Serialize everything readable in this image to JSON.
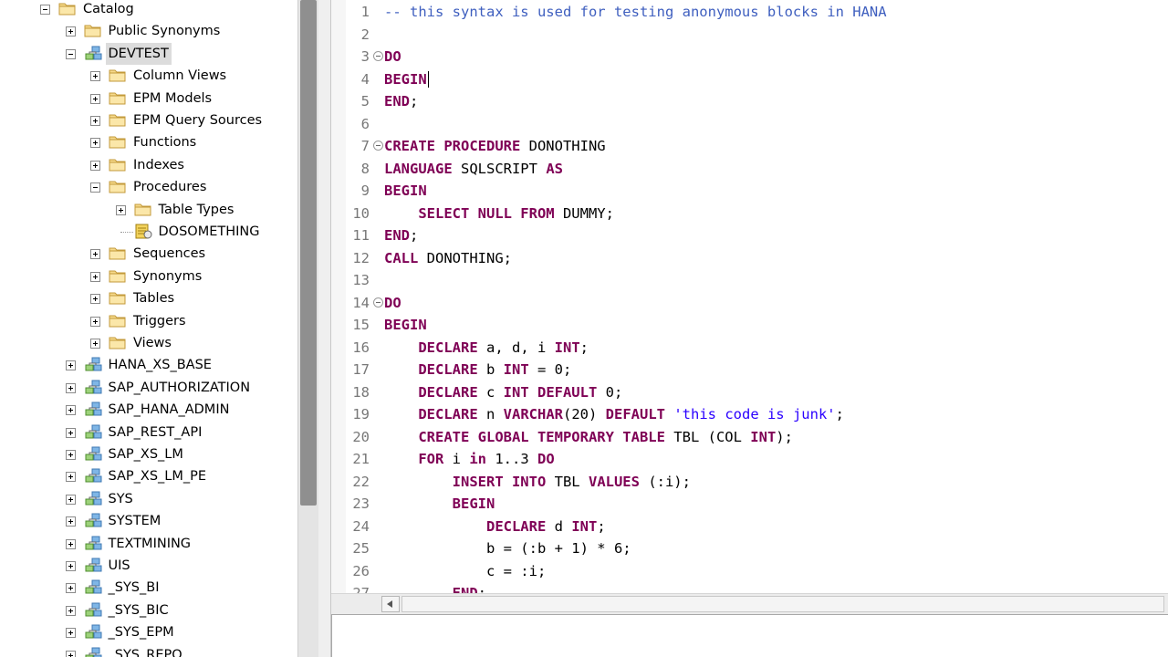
{
  "tree": {
    "nodes": [
      {
        "label": "Catalog",
        "level": 0,
        "expander": "minus",
        "icon": "folder-icon"
      },
      {
        "label": "Public Synonyms",
        "level": 1,
        "expander": "plus",
        "icon": "folder-icon"
      },
      {
        "label": "DEVTEST",
        "level": 1,
        "expander": "minus",
        "icon": "schema-icon",
        "selected": true
      },
      {
        "label": "Column Views",
        "level": 2,
        "expander": "plus",
        "icon": "folder-icon"
      },
      {
        "label": "EPM Models",
        "level": 2,
        "expander": "plus",
        "icon": "folder-icon"
      },
      {
        "label": "EPM Query Sources",
        "level": 2,
        "expander": "plus",
        "icon": "folder-icon"
      },
      {
        "label": "Functions",
        "level": 2,
        "expander": "plus",
        "icon": "folder-icon"
      },
      {
        "label": "Indexes",
        "level": 2,
        "expander": "plus",
        "icon": "folder-icon"
      },
      {
        "label": "Procedures",
        "level": 2,
        "expander": "minus",
        "icon": "folder-icon"
      },
      {
        "label": "Table Types",
        "level": 3,
        "expander": "plus",
        "icon": "folder-icon"
      },
      {
        "label": "DOSOMETHING",
        "level": 3,
        "expander": "none",
        "icon": "procedure-icon"
      },
      {
        "label": "Sequences",
        "level": 2,
        "expander": "plus",
        "icon": "folder-icon"
      },
      {
        "label": "Synonyms",
        "level": 2,
        "expander": "plus",
        "icon": "folder-icon"
      },
      {
        "label": "Tables",
        "level": 2,
        "expander": "plus",
        "icon": "folder-icon"
      },
      {
        "label": "Triggers",
        "level": 2,
        "expander": "plus",
        "icon": "folder-icon"
      },
      {
        "label": "Views",
        "level": 2,
        "expander": "plus",
        "icon": "folder-icon"
      },
      {
        "label": "HANA_XS_BASE",
        "level": 1,
        "expander": "plus",
        "icon": "schema-icon"
      },
      {
        "label": "SAP_AUTHORIZATION",
        "level": 1,
        "expander": "plus",
        "icon": "schema-icon"
      },
      {
        "label": "SAP_HANA_ADMIN",
        "level": 1,
        "expander": "plus",
        "icon": "schema-icon"
      },
      {
        "label": "SAP_REST_API",
        "level": 1,
        "expander": "plus",
        "icon": "schema-icon"
      },
      {
        "label": "SAP_XS_LM",
        "level": 1,
        "expander": "plus",
        "icon": "schema-icon"
      },
      {
        "label": "SAP_XS_LM_PE",
        "level": 1,
        "expander": "plus",
        "icon": "schema-icon"
      },
      {
        "label": "SYS",
        "level": 1,
        "expander": "plus",
        "icon": "schema-icon"
      },
      {
        "label": "SYSTEM",
        "level": 1,
        "expander": "plus",
        "icon": "schema-icon"
      },
      {
        "label": "TEXTMINING",
        "level": 1,
        "expander": "plus",
        "icon": "schema-icon"
      },
      {
        "label": "UIS",
        "level": 1,
        "expander": "plus",
        "icon": "schema-icon"
      },
      {
        "label": "_SYS_BI",
        "level": 1,
        "expander": "plus",
        "icon": "schema-icon"
      },
      {
        "label": "_SYS_BIC",
        "level": 1,
        "expander": "plus",
        "icon": "schema-icon"
      },
      {
        "label": "_SYS_EPM",
        "level": 1,
        "expander": "plus",
        "icon": "schema-icon"
      },
      {
        "label": "_SYS_REPO",
        "level": 1,
        "expander": "plus",
        "icon": "schema-icon"
      }
    ]
  },
  "editor": {
    "lines": [
      {
        "n": "1",
        "fold": false,
        "tokens": [
          [
            "cm",
            "-- this syntax is used for testing anonymous blocks in HANA"
          ]
        ]
      },
      {
        "n": "2",
        "fold": false,
        "tokens": []
      },
      {
        "n": "3",
        "fold": true,
        "tokens": [
          [
            "kw",
            "DO"
          ]
        ]
      },
      {
        "n": "4",
        "fold": false,
        "tokens": [
          [
            "kw",
            "BEGIN"
          ]
        ],
        "caret": true
      },
      {
        "n": "5",
        "fold": false,
        "tokens": [
          [
            "kw",
            "END"
          ],
          [
            "tx",
            ";"
          ]
        ]
      },
      {
        "n": "6",
        "fold": false,
        "tokens": []
      },
      {
        "n": "7",
        "fold": true,
        "tokens": [
          [
            "kw",
            "CREATE PROCEDURE"
          ],
          [
            "tx",
            " DONOTHING"
          ]
        ]
      },
      {
        "n": "8",
        "fold": false,
        "tokens": [
          [
            "kw",
            "LANGUAGE"
          ],
          [
            "tx",
            " SQLSCRIPT "
          ],
          [
            "kw",
            "AS"
          ]
        ]
      },
      {
        "n": "9",
        "fold": false,
        "tokens": [
          [
            "kw",
            "BEGIN"
          ]
        ]
      },
      {
        "n": "10",
        "fold": false,
        "tokens": [
          [
            "tx",
            "    "
          ],
          [
            "kw",
            "SELECT NULL FROM"
          ],
          [
            "tx",
            " DUMMY;"
          ]
        ]
      },
      {
        "n": "11",
        "fold": false,
        "tokens": [
          [
            "kw",
            "END"
          ],
          [
            "tx",
            ";"
          ]
        ]
      },
      {
        "n": "12",
        "fold": false,
        "tokens": [
          [
            "kw",
            "CALL"
          ],
          [
            "tx",
            " DONOTHING;"
          ]
        ]
      },
      {
        "n": "13",
        "fold": false,
        "tokens": []
      },
      {
        "n": "14",
        "fold": true,
        "tokens": [
          [
            "kw",
            "DO"
          ]
        ]
      },
      {
        "n": "15",
        "fold": false,
        "tokens": [
          [
            "kw",
            "BEGIN"
          ]
        ]
      },
      {
        "n": "16",
        "fold": false,
        "tokens": [
          [
            "tx",
            "    "
          ],
          [
            "kw",
            "DECLARE"
          ],
          [
            "tx",
            " a, d, i "
          ],
          [
            "kw",
            "INT"
          ],
          [
            "tx",
            ";"
          ]
        ]
      },
      {
        "n": "17",
        "fold": false,
        "tokens": [
          [
            "tx",
            "    "
          ],
          [
            "kw",
            "DECLARE"
          ],
          [
            "tx",
            " b "
          ],
          [
            "kw",
            "INT"
          ],
          [
            "tx",
            " = 0;"
          ]
        ]
      },
      {
        "n": "18",
        "fold": false,
        "tokens": [
          [
            "tx",
            "    "
          ],
          [
            "kw",
            "DECLARE"
          ],
          [
            "tx",
            " c "
          ],
          [
            "kw",
            "INT DEFAULT"
          ],
          [
            "tx",
            " 0;"
          ]
        ]
      },
      {
        "n": "19",
        "fold": false,
        "tokens": [
          [
            "tx",
            "    "
          ],
          [
            "kw",
            "DECLARE"
          ],
          [
            "tx",
            " n "
          ],
          [
            "kw",
            "VARCHAR"
          ],
          [
            "tx",
            "(20) "
          ],
          [
            "kw",
            "DEFAULT"
          ],
          [
            "tx",
            " "
          ],
          [
            "st",
            "'this code is junk'"
          ],
          [
            "tx",
            ";"
          ]
        ]
      },
      {
        "n": "20",
        "fold": false,
        "tokens": [
          [
            "tx",
            "    "
          ],
          [
            "kw",
            "CREATE GLOBAL TEMPORARY TABLE"
          ],
          [
            "tx",
            " TBL (COL "
          ],
          [
            "kw",
            "INT"
          ],
          [
            "tx",
            ");"
          ]
        ]
      },
      {
        "n": "21",
        "fold": false,
        "tokens": [
          [
            "tx",
            "    "
          ],
          [
            "kw",
            "FOR"
          ],
          [
            "tx",
            " i "
          ],
          [
            "kw",
            "in"
          ],
          [
            "tx",
            " 1..3 "
          ],
          [
            "kw",
            "DO"
          ]
        ]
      },
      {
        "n": "22",
        "fold": false,
        "tokens": [
          [
            "tx",
            "        "
          ],
          [
            "kw",
            "INSERT INTO"
          ],
          [
            "tx",
            " TBL "
          ],
          [
            "kw",
            "VALUES"
          ],
          [
            "tx",
            " (:i);"
          ]
        ]
      },
      {
        "n": "23",
        "fold": false,
        "tokens": [
          [
            "tx",
            "        "
          ],
          [
            "kw",
            "BEGIN"
          ]
        ]
      },
      {
        "n": "24",
        "fold": false,
        "tokens": [
          [
            "tx",
            "            "
          ],
          [
            "kw",
            "DECLARE"
          ],
          [
            "tx",
            " d "
          ],
          [
            "kw",
            "INT"
          ],
          [
            "tx",
            ";"
          ]
        ]
      },
      {
        "n": "25",
        "fold": false,
        "tokens": [
          [
            "tx",
            "            b = (:b + 1) * 6;"
          ]
        ]
      },
      {
        "n": "26",
        "fold": false,
        "tokens": [
          [
            "tx",
            "            c = :i;"
          ]
        ]
      },
      {
        "n": "27",
        "fold": false,
        "tokens": [
          [
            "tx",
            "        "
          ],
          [
            "kw",
            "END"
          ],
          [
            "tx",
            ";"
          ]
        ]
      }
    ]
  },
  "colors": {
    "keyword": "#7f0055",
    "comment": "#3f5fbf",
    "string": "#2a00ff",
    "line_number": "#787878"
  }
}
